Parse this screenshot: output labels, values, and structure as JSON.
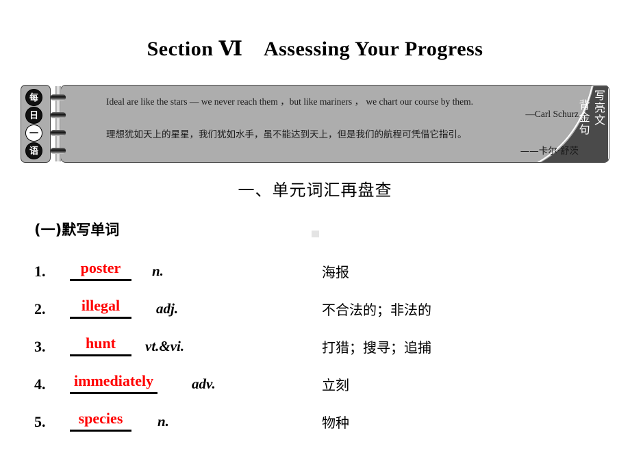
{
  "page": {
    "title": "Section Ⅵ　Assessing Your Progress"
  },
  "quote_banner": {
    "tab_chars": [
      "每",
      "日",
      "一",
      "语"
    ],
    "english_quote": "Ideal are like the stars — we never reach them ，but like mariners ， we chart our course by them.",
    "english_attribution": "—Carl Schurz",
    "chinese_quote": "理想犹如天上的星星，我们犹如水手，虽不能达到天上，但是我们的航程可凭借它指引。",
    "chinese_attribution": "——卡尔·舒茨",
    "corner_text_right": "写亮文",
    "corner_text_left": "背金句",
    "colors": {
      "banner_background": "#adadad",
      "corner_background": "#4a4a4a",
      "border": "#4a4a4a"
    }
  },
  "section": {
    "heading": "一、单元词汇再盘查",
    "sub_heading": "(一)默写单词"
  },
  "words": {
    "answer_color": "#ff0000",
    "items": [
      {
        "num": "1.",
        "answer": "poster",
        "pos": "n.",
        "meaning": "海报"
      },
      {
        "num": "2.",
        "answer": "illegal",
        "pos": "adj.",
        "meaning": "不合法的；非法的"
      },
      {
        "num": "3.",
        "answer": "hunt",
        "pos": "vt.&vi.",
        "meaning": "打猎；搜寻；追捕"
      },
      {
        "num": "4.",
        "answer": "immediately",
        "pos": "adv.",
        "meaning": "立刻"
      },
      {
        "num": "5.",
        "answer": "species",
        "pos": "n.",
        "meaning": "物种"
      }
    ]
  }
}
